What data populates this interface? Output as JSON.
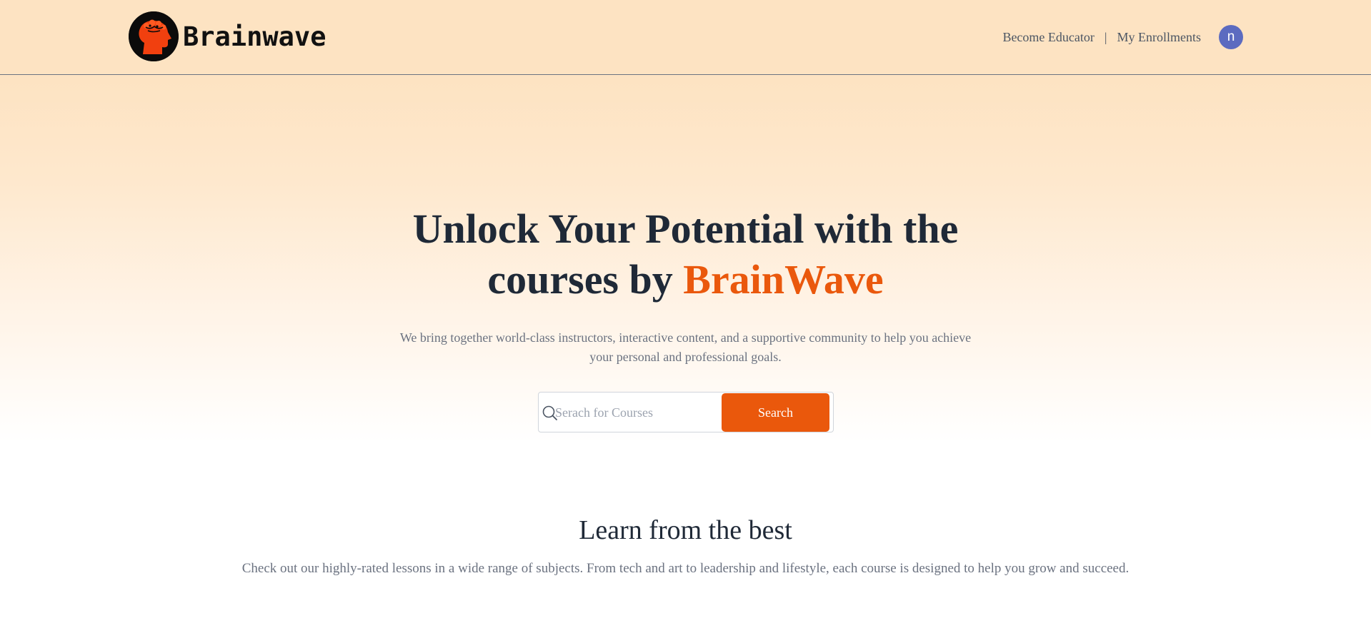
{
  "header": {
    "brand_name": "Brainwave",
    "nav": {
      "become_educator": "Become Educator",
      "separator": "|",
      "my_enrollments": "My Enrollments"
    },
    "avatar_initial": "n",
    "avatar_color": "#5c6bc0"
  },
  "hero": {
    "title_line1": "Unlock Your Potential with the",
    "title_line2_prefix": "courses by ",
    "title_accent": "BrainWave",
    "subtitle_line1": "We bring together world-class instructors, interactive content, and a supportive community to help you achieve",
    "subtitle_line2": "your personal and professional goals.",
    "search": {
      "placeholder": "Serach for Courses",
      "value": "",
      "button_label": "Search",
      "icon": "search-icon"
    }
  },
  "section": {
    "title": "Learn from the best",
    "subtitle": "Check out our highly-rated lessons in a wide range of subjects. From tech and art to leadership and lifestyle, each course is designed to help you grow and succeed."
  },
  "colors": {
    "accent": "#ea580c",
    "header_bg": "#fde3c2",
    "heading": "#1f2937",
    "muted_text": "#6b7280"
  }
}
